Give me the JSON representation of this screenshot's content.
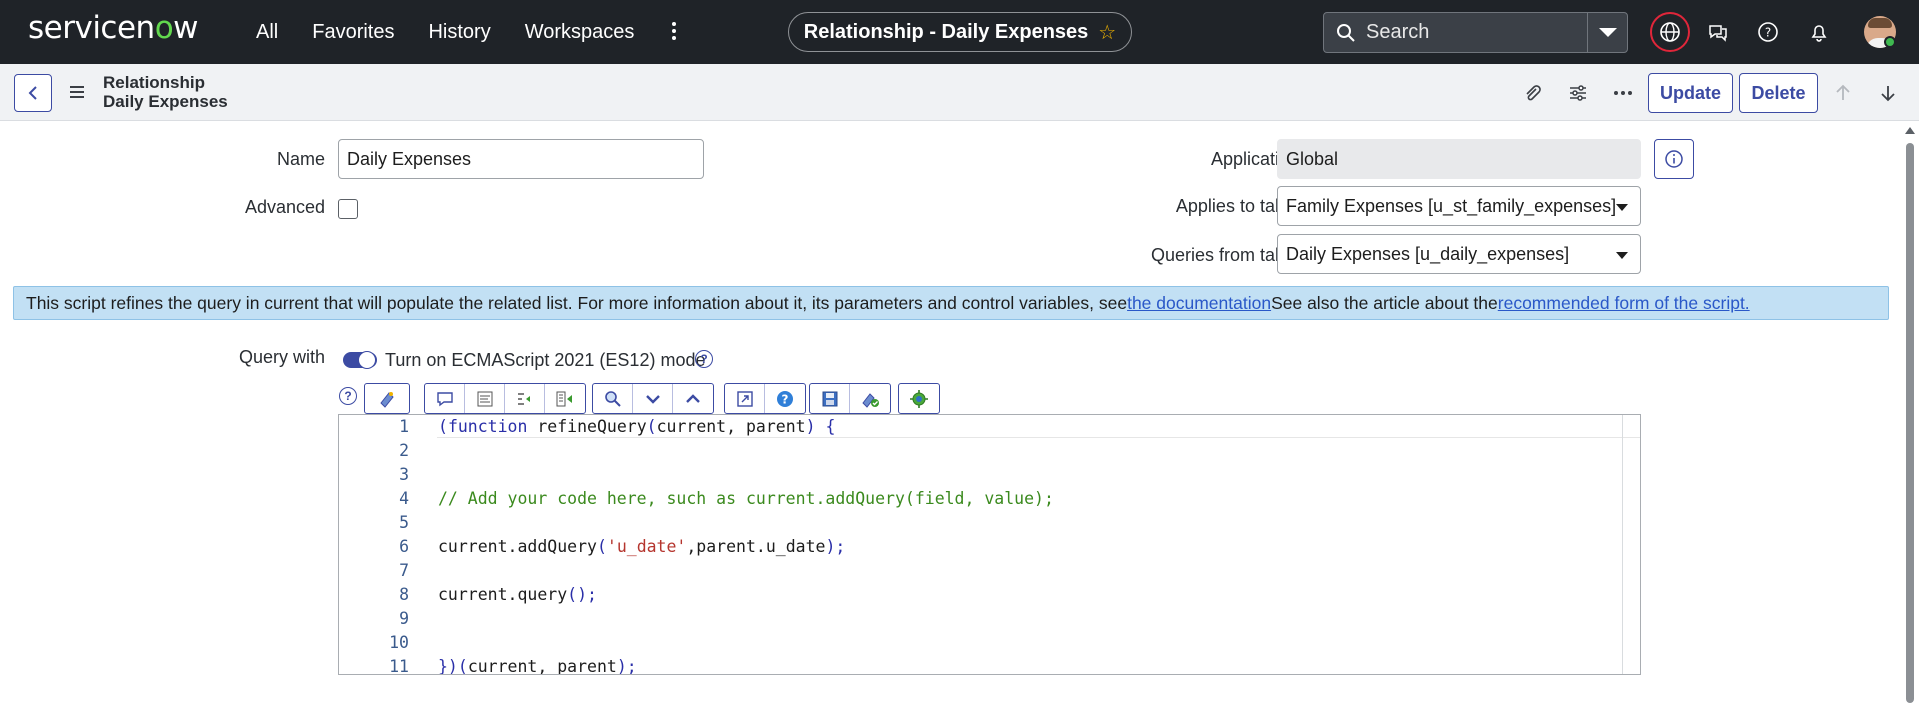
{
  "app": {
    "logo": {
      "pre": "servicen",
      "o": "o",
      "post": "w"
    },
    "nav": [
      "All",
      "Favorites",
      "History",
      "Workspaces"
    ],
    "title": "Relationship - Daily Expenses",
    "search_placeholder": "Search"
  },
  "form_header": {
    "record_type": "Relationship",
    "record_name": "Daily Expenses",
    "update_label": "Update",
    "delete_label": "Delete"
  },
  "fields": {
    "name_label": "Name",
    "name_value": "Daily Expenses",
    "advanced_label": "Advanced",
    "application_label": "Application",
    "application_value": "Global",
    "applies_label": "Applies to table",
    "applies_value": "Family Expenses [u_st_family_expenses]",
    "queries_label": "Queries from table",
    "queries_value": "Daily Expenses [u_daily_expenses]"
  },
  "banner": {
    "text1": "This script refines the query in current that will populate the related list. For more information about it, its parameters and control variables, see ",
    "link1": "the documentation",
    "text2": " See also the article about the ",
    "link2": "recommended form of the script."
  },
  "query": {
    "label": "Query with",
    "toggle_label": "Turn on ECMAScript 2021 (ES12) mode"
  },
  "editor": {
    "line_numbers": [
      "1",
      "2",
      "3",
      "4",
      "5",
      "6",
      "7",
      "8",
      "9",
      "10",
      "11"
    ],
    "l1_a": "(",
    "l1_b": "function",
    "l1_c": " refineQuery",
    "l1_d": "(",
    "l1_e": "current, parent",
    "l1_f": ") {",
    "l4": "// Add your code here, such as current.addQuery(field, value);",
    "l6_a": "current.addQuery",
    "l6_b": "(",
    "l6_c": "'u_date'",
    "l6_d": ",parent.u_date",
    "l6_e": ");",
    "l8_a": "current.query",
    "l8_b": "();",
    "l11_a": "})(",
    "l11_b": "current, parent",
    "l11_c": ");"
  },
  "colors": {
    "topbar": "#1f2328",
    "accent": "#3c4ba3",
    "logo_green": "#62d84e",
    "banner_bg": "#c2e0f4"
  }
}
